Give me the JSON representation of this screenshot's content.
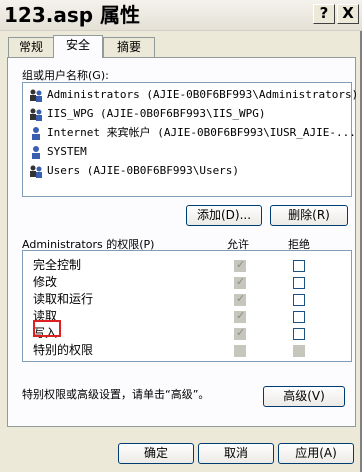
{
  "window": {
    "title": "123.asp 属性",
    "help_button": "?",
    "close_button": "X"
  },
  "tabs": [
    {
      "label": "常规"
    },
    {
      "label": "安全"
    },
    {
      "label": "摘要"
    }
  ],
  "groups": {
    "label": "组或用户名称(G):",
    "items": [
      {
        "name": "Administrators (AJIE-0B0F6BF993\\Administrators)",
        "icon": "group-icon",
        "selected": true
      },
      {
        "name": "IIS_WPG (AJIE-0B0F6BF993\\IIS_WPG)",
        "icon": "group-icon"
      },
      {
        "name": "Internet 来宾帐户 (AJIE-0B0F6BF993\\IUSR_AJIE-...",
        "icon": "user-icon"
      },
      {
        "name": "SYSTEM",
        "icon": "user-icon"
      },
      {
        "name": "Users (AJIE-0B0F6BF993\\Users)",
        "icon": "group-icon"
      }
    ],
    "add_button": "添加(D)...",
    "remove_button": "删除(R)"
  },
  "permissions": {
    "label": "Administrators 的权限(P)",
    "allow_header": "允许",
    "deny_header": "拒绝",
    "rows": [
      {
        "name": "完全控制",
        "allow": true,
        "deny": false
      },
      {
        "name": "修改",
        "allow": true,
        "deny": false
      },
      {
        "name": "读取和运行",
        "allow": true,
        "deny": false
      },
      {
        "name": "读取",
        "allow": true,
        "deny": false
      },
      {
        "name": "写入",
        "allow": true,
        "deny": false
      },
      {
        "name": "特别的权限",
        "allow": false,
        "deny": false
      }
    ]
  },
  "advanced": {
    "hint": "特别权限或高级设置，请单击“高级”。",
    "button": "高级(V)"
  },
  "footer": {
    "ok": "确定",
    "cancel": "取消",
    "apply": "应用(A)"
  }
}
